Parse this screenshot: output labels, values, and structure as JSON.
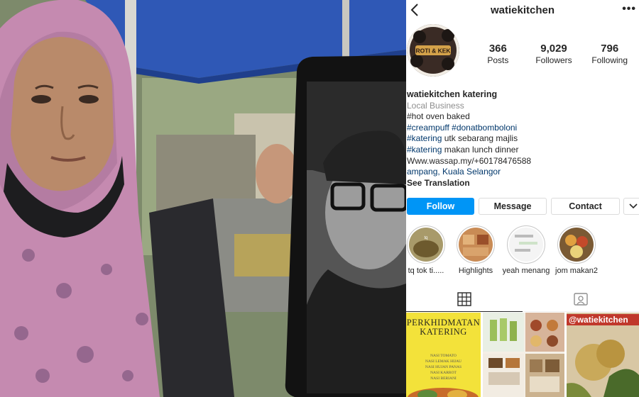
{
  "profile": {
    "username": "watiekitchen",
    "stats": [
      {
        "value": "366",
        "label": "Posts"
      },
      {
        "value": "9,029",
        "label": "Followers"
      },
      {
        "value": "796",
        "label": "Following"
      }
    ],
    "display_name": "watiekitchen katering",
    "category": "Local Business",
    "bio_lines": [
      {
        "text": "#hot oven baked",
        "kind": "plain"
      },
      {
        "text": "#creampuff #donatbomboloni",
        "kind": "tag"
      },
      {
        "tag": "#katering",
        "rest": " utk sebarang majlis"
      },
      {
        "tag": "#katering",
        "rest": " makan lunch dinner"
      },
      {
        "text": "Www.wassap.my/+60178476588",
        "kind": "plain"
      },
      {
        "text": "ampang, Kuala Selangor",
        "kind": "loc"
      }
    ],
    "see_translation": "See Translation",
    "avatar_text": [
      "ROTI & KEK"
    ]
  },
  "actions": {
    "follow": "Follow",
    "message": "Message",
    "contact": "Contact"
  },
  "highlights": [
    {
      "label": "tq tok ti.....",
      "icon": "highlight-food-icon"
    },
    {
      "label": "Highlights",
      "icon": "highlight-dishes-icon"
    },
    {
      "label": "yeah menang",
      "icon": "highlight-chat-icon"
    },
    {
      "label": "jom makan2",
      "icon": "highlight-platter-icon"
    }
  ],
  "tabs": [
    {
      "name": "grid-tab",
      "icon": "grid-icon"
    },
    {
      "name": "tagged-tab",
      "icon": "tagged-icon"
    }
  ],
  "posts": {
    "post1_title": [
      "PERKHIDMATAN",
      "KATERING"
    ],
    "post1_lines": [
      "NASI TOMATO",
      "NASI LEMAK HIJAU",
      "NASI HUJAN PANAS",
      "NASI KARROT",
      "NASI BERIANI"
    ],
    "post3_tag": "@watiekitchen"
  },
  "colors": {
    "follow_blue": "#0095f6",
    "hashtag_link": "#00376b",
    "secondary_text": "#8e8e8e",
    "border": "#dbdbdb"
  }
}
